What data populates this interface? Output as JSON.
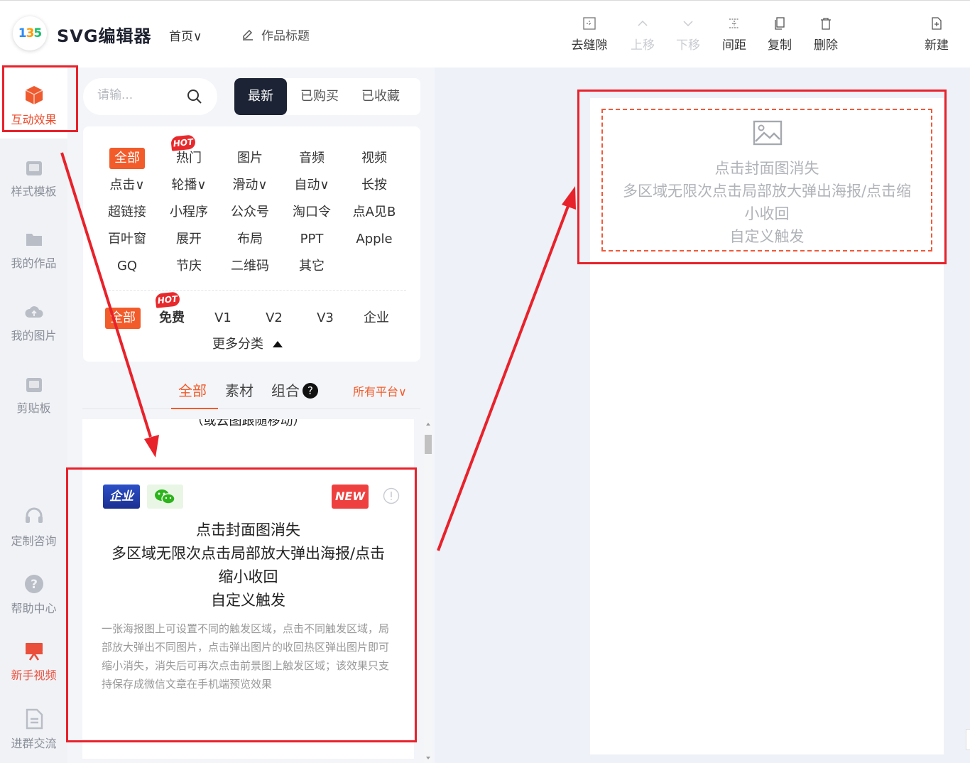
{
  "app": {
    "logo_text": [
      "1",
      "3",
      "5"
    ],
    "title": "SVG编辑器",
    "home_menu": "首页∨",
    "work_title": "作品标题"
  },
  "toolbar": {
    "items": [
      {
        "label": "去缝隙",
        "icon": "gap-remove-icon",
        "disabled": false
      },
      {
        "label": "上移",
        "icon": "chevron-up-icon",
        "disabled": true
      },
      {
        "label": "下移",
        "icon": "chevron-down-icon",
        "disabled": true
      },
      {
        "label": "间距",
        "icon": "spacing-icon",
        "disabled": false
      },
      {
        "label": "复制",
        "icon": "copy-icon",
        "disabled": false
      },
      {
        "label": "删除",
        "icon": "trash-icon",
        "disabled": false
      },
      {
        "label": "新建",
        "icon": "new-file-icon",
        "disabled": false
      }
    ]
  },
  "sidebar": {
    "items": [
      {
        "label": "互动效果",
        "icon": "cube-icon",
        "active": true
      },
      {
        "label": "样式模板",
        "icon": "template-icon"
      },
      {
        "label": "我的作品",
        "icon": "folder-icon"
      },
      {
        "label": "我的图片",
        "icon": "cloud-upload-icon"
      },
      {
        "label": "剪贴板",
        "icon": "clipboard-icon"
      },
      {
        "label": "定制咨询",
        "icon": "headset-icon"
      },
      {
        "label": "帮助中心",
        "icon": "help-icon"
      },
      {
        "label": "新手视频",
        "icon": "video-icon"
      },
      {
        "label": "进群交流",
        "icon": "document-icon"
      }
    ]
  },
  "search": {
    "placeholder": "请输..."
  },
  "filter_tabs": [
    "最新",
    "已购买",
    "已收藏"
  ],
  "categories": {
    "rows": [
      [
        "全部",
        "热门",
        "图片",
        "音频",
        "视频"
      ],
      [
        "点击∨",
        "轮播∨",
        "滑动∨",
        "自动∨",
        "长按"
      ],
      [
        "超链接",
        "小程序",
        "公众号",
        "淘口令",
        "点A见B"
      ],
      [
        "百叶窗",
        "展开",
        "布局",
        "PPT",
        "Apple"
      ],
      [
        "GQ",
        "节庆",
        "二维码",
        "其它"
      ]
    ],
    "hot_label": "HOT",
    "tiers": [
      "全部",
      "免费",
      "V1",
      "V2",
      "V3",
      "企业"
    ],
    "more": "更多分类"
  },
  "sub_tabs": [
    "全部",
    "素材",
    "组合"
  ],
  "help_glyph": "?",
  "platform_filter": "所有平台∨",
  "list": {
    "prev_item_text": "（或云图跟随移动）",
    "card": {
      "badge_enterprise": "企业",
      "badge_new": "NEW",
      "title": "点击封面图消失\n多区域无限次点击局部放大弹出海报/点击\n缩小收回\n自定义触发",
      "description": "一张海报图上可设置不同的触发区域，点击不同触发区域，局部放大弹出不同图片，点击弹出图片的收回热区弹出图片即可缩小消失，消失后可再次点击前景图上触发区域；该效果只支持保存成微信文章在手机端预览效果"
    }
  },
  "canvas": {
    "placeholder_text": "点击封面图消失\n多区域无限次点击局部放大弹出海报/点击缩\n小收回\n自定义触发"
  },
  "colors": {
    "accent": "#f25b2a",
    "dark_tab": "#1b2334",
    "annotation_red": "#e8222b"
  }
}
